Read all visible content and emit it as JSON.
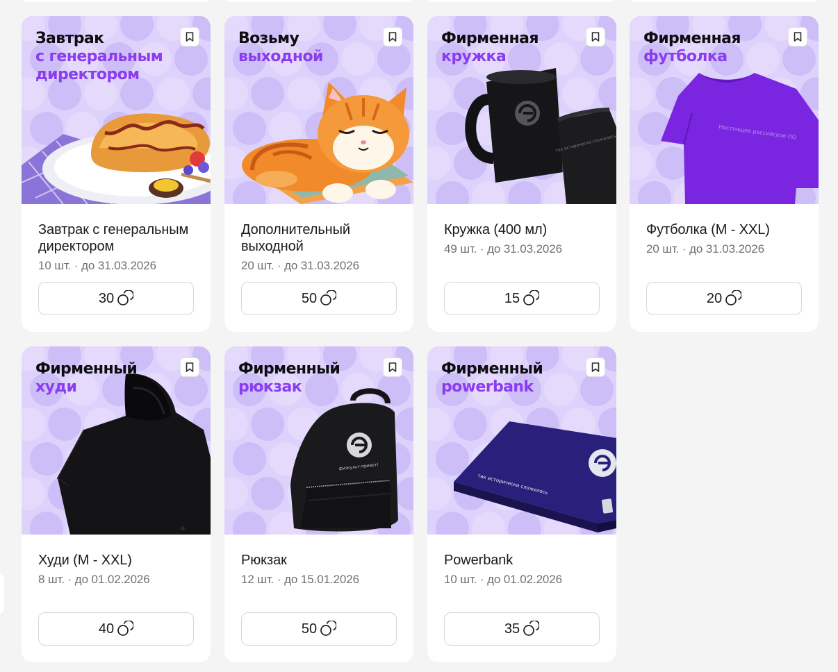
{
  "colors": {
    "page_bg": "#f4f4f5",
    "card_bg": "#ffffff",
    "hero_bg": "#ddd2fb",
    "hero_title_dark": "#0e0e12",
    "hero_title_accent": "#8a3cf0",
    "meta_text": "#6f6f78"
  },
  "products": [
    {
      "hero_line1": "Завтрак",
      "hero_line2": "с генеральным директором",
      "name": "Завтрак с генеральным директором",
      "meta": "10 шт. · до 31.03.2026",
      "price": "30",
      "image": "croissant-breakfast"
    },
    {
      "hero_line1": "Возьму",
      "hero_line2": "выходной",
      "name": "Дополнительный выходной",
      "meta": "20 шт. · до 31.03.2026",
      "price": "50",
      "image": "sleeping-cat"
    },
    {
      "hero_line1": "Фирменная",
      "hero_line2": "кружка",
      "name": "Кружка (400 мл)",
      "meta": "49 шт. · до 31.03.2026",
      "price": "15",
      "image": "black-mugs"
    },
    {
      "hero_line1": "Фирменная",
      "hero_line2": "футболка",
      "name": "Футболка (M - XXL)",
      "meta": "20 шт. · до 31.03.2026",
      "price": "20",
      "image": "purple-tshirt",
      "print_text": "Настоящее российское ПО"
    },
    {
      "hero_line1": "Фирменный",
      "hero_line2": "худи",
      "name": "Худи (M - XXL)",
      "meta": "8 шт. · до 01.02.2026",
      "price": "40",
      "image": "black-hoodie"
    },
    {
      "hero_line1": "Фирменный",
      "hero_line2": "рюкзак",
      "name": "Рюкзак",
      "meta": "12 шт. · до 15.01.2026",
      "price": "50",
      "image": "black-backpack",
      "print_text": "физкульт-привет!"
    },
    {
      "hero_line1": "Фирменный",
      "hero_line2": "powerbank",
      "name": "Powerbank",
      "meta": "10 шт. · до 01.02.2026",
      "price": "35",
      "image": "navy-powerbank",
      "print_text": "так исторически сложилось"
    }
  ]
}
